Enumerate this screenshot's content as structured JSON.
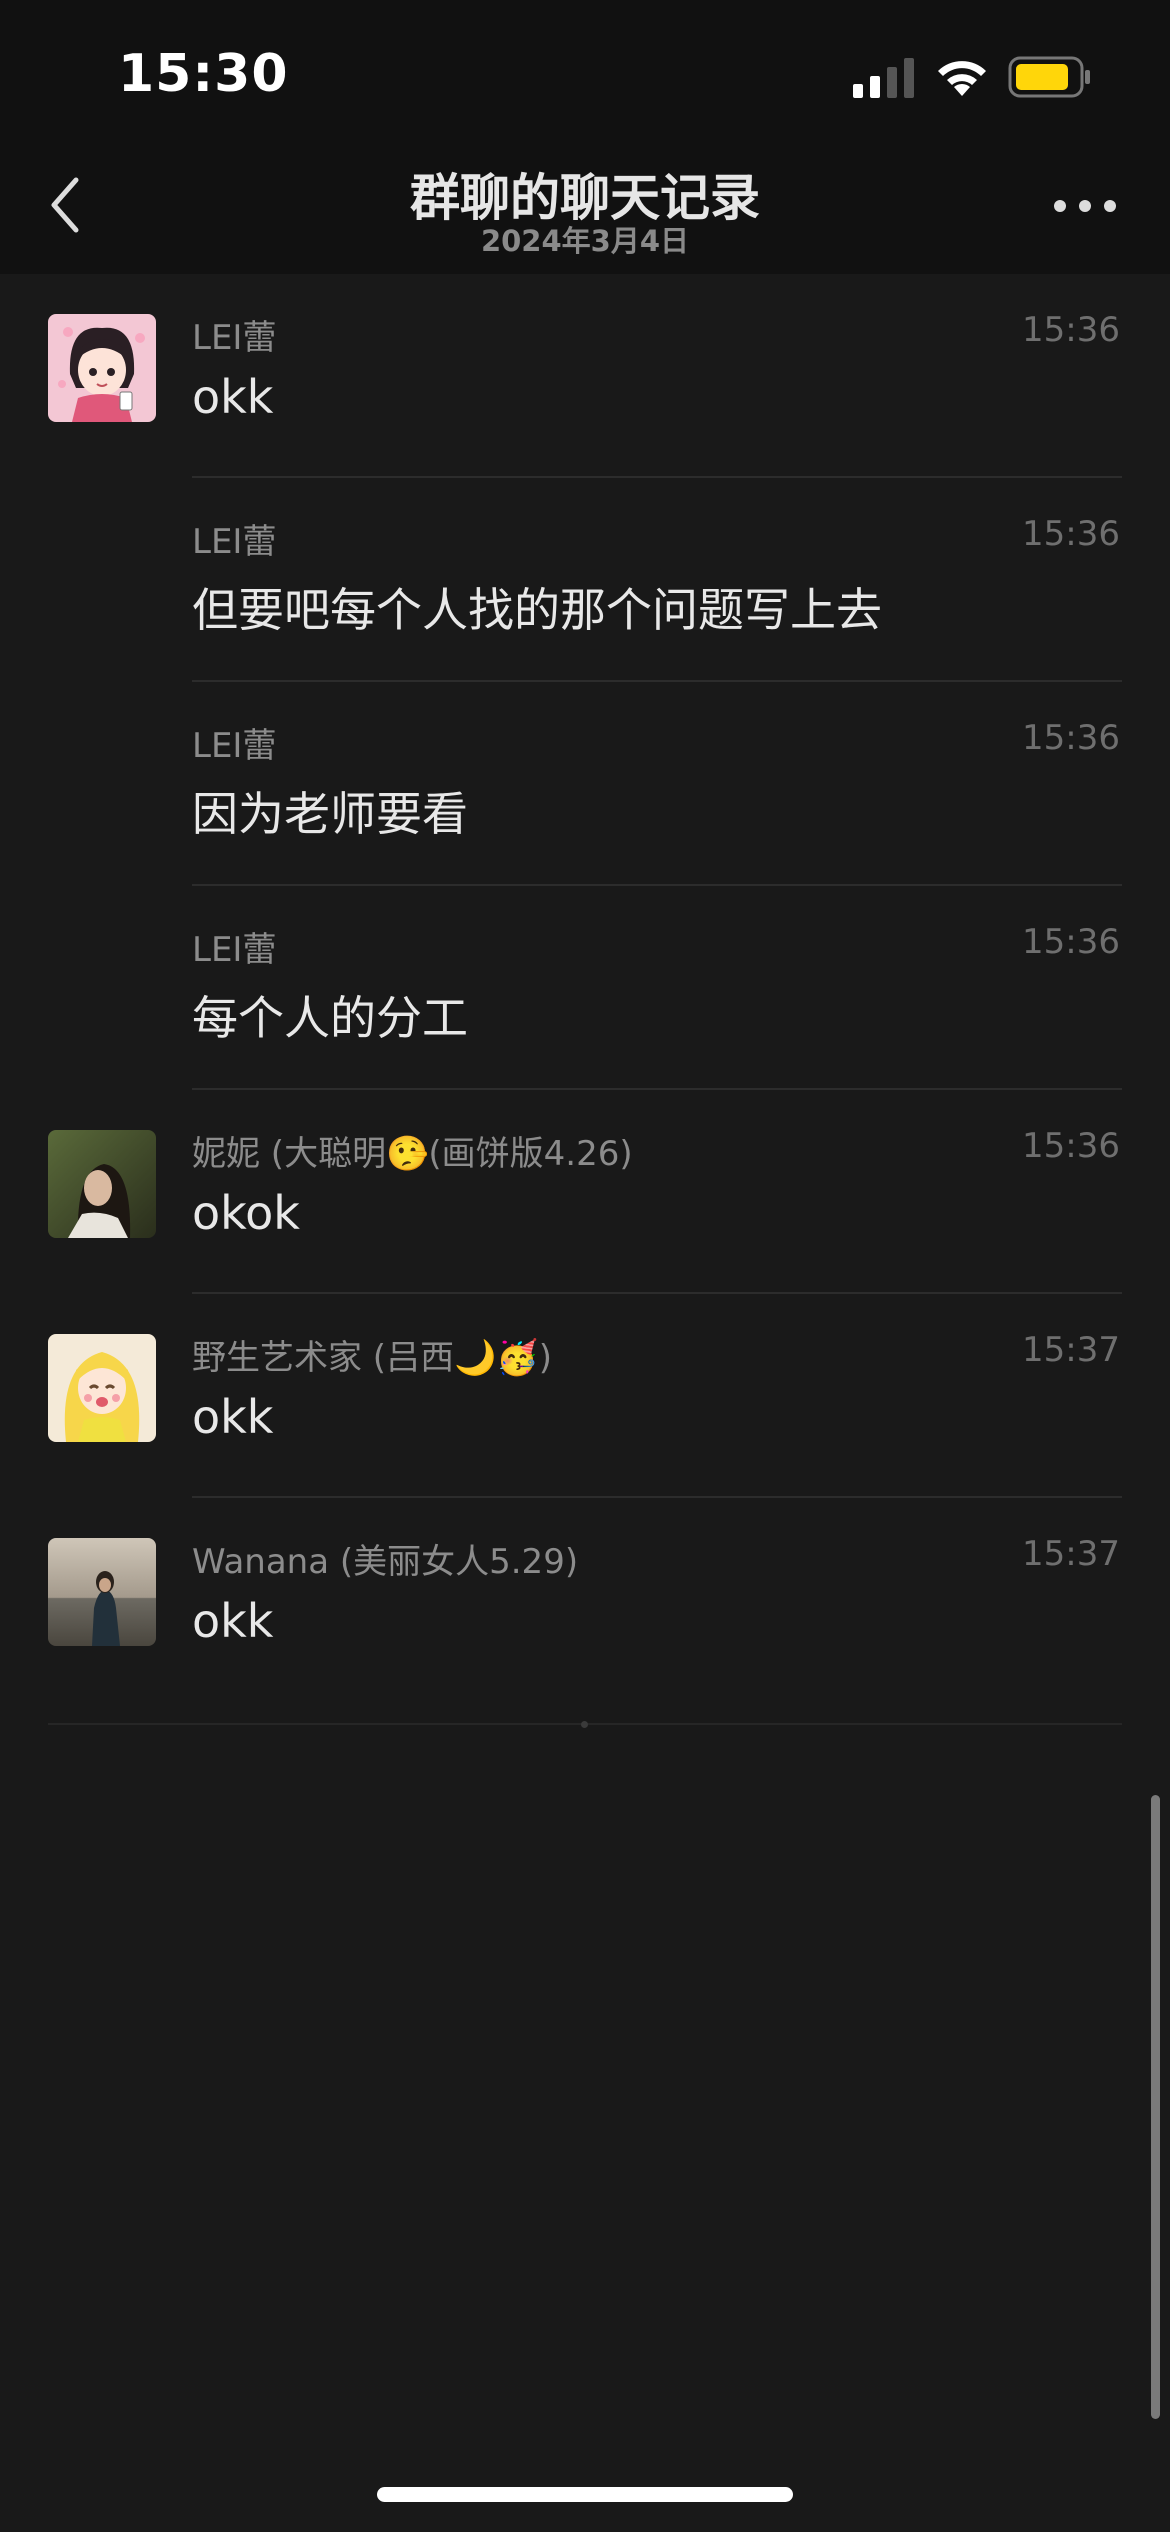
{
  "status_bar": {
    "time": "15:30",
    "battery_color": "#ffd60a",
    "icons": [
      "signal-icon",
      "wifi-icon",
      "battery-icon"
    ]
  },
  "nav": {
    "title": "群聊的聊天记录",
    "subtitle": "2024年3月4日",
    "back_icon": "chevron-left-icon",
    "more_icon": "more-dots-icon"
  },
  "messages": [
    {
      "sender": "LEI蕾",
      "time": "15:36",
      "text": "okk",
      "avatar": "cartoon-girl-pink"
    },
    {
      "sender": "LEI蕾",
      "time": "15:36",
      "text": "但要吧每个人找的那个问题写上去",
      "avatar": null
    },
    {
      "sender": "LEI蕾",
      "time": "15:36",
      "text": "因为老师要看",
      "avatar": null
    },
    {
      "sender": "LEI蕾",
      "time": "15:36",
      "text": "每个人的分工",
      "avatar": null
    },
    {
      "sender": "妮妮 (大聪明🤥(画饼版4.26)",
      "time": "15:36",
      "text": "okok",
      "avatar": "photo-girl-dark"
    },
    {
      "sender": "野生艺术家 (吕西🌙🥳)",
      "time": "15:37",
      "text": "okk",
      "avatar": "cartoon-girl-yellow"
    },
    {
      "sender": "Wanana (美丽女人5.29)",
      "time": "15:37",
      "text": "okk",
      "avatar": "photo-beach"
    }
  ]
}
